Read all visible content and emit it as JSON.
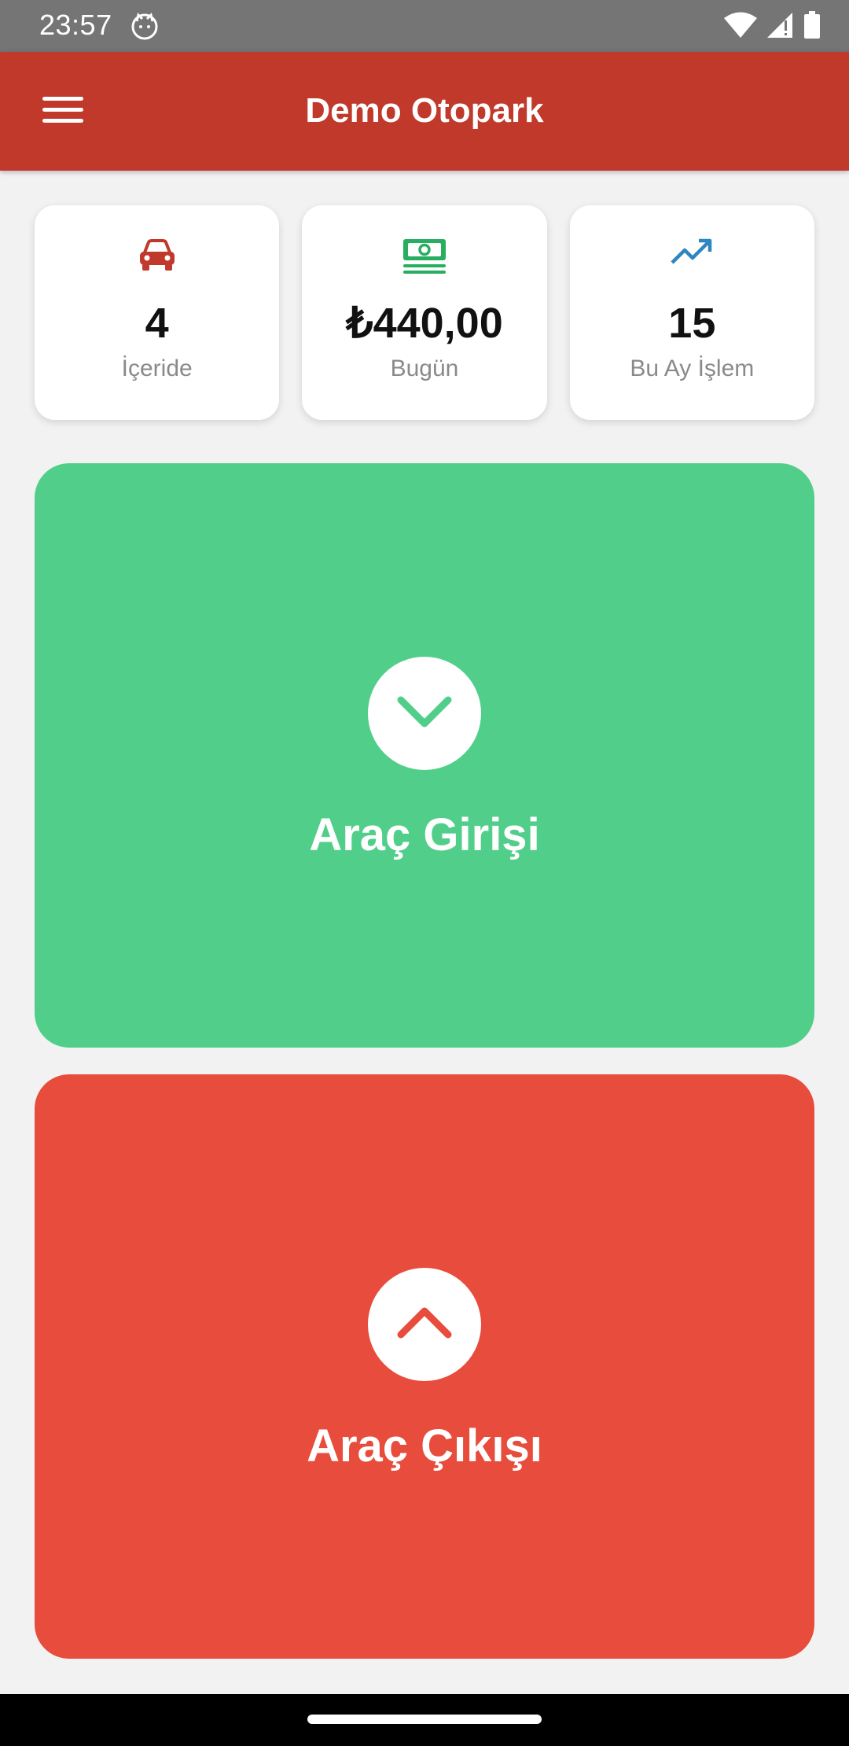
{
  "status_bar": {
    "time": "23:57",
    "icons": [
      "cat-notification-icon",
      "wifi-icon",
      "signal-icon",
      "battery-icon"
    ]
  },
  "app_bar": {
    "title": "Demo Otopark",
    "menu_icon": "hamburger-menu-icon"
  },
  "stats": [
    {
      "icon": "car-icon",
      "icon_color": "#c0392b",
      "value": "4",
      "label": "İçeride"
    },
    {
      "icon": "money-icon",
      "icon_color": "#27ae60",
      "value": "₺440,00",
      "label": "Bugün"
    },
    {
      "icon": "trending-up-icon",
      "icon_color": "#2e86c1",
      "value": "15",
      "label": "Bu Ay İşlem"
    }
  ],
  "actions": {
    "entry": {
      "label": "Araç Girişi",
      "icon": "chevron-down-icon",
      "color": "#51cf8a"
    },
    "exit": {
      "label": "Araç Çıkışı",
      "icon": "chevron-up-icon",
      "color": "#e74c3c"
    }
  },
  "colors": {
    "primary": "#c0392b",
    "background": "#f2f2f2"
  }
}
